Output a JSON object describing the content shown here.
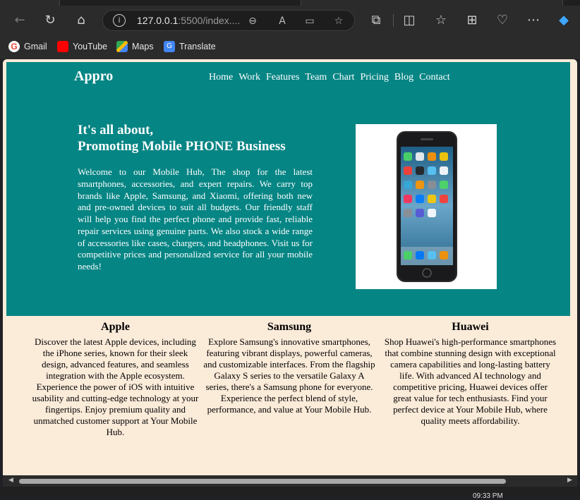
{
  "browser": {
    "url_host": "127.0.0.1",
    "url_rest": ":5500/index....",
    "bookmarks": [
      {
        "label": "Gmail",
        "color": "#ea4335"
      },
      {
        "label": "YouTube",
        "color": "#ff0000"
      },
      {
        "label": "Maps",
        "color": "#34a853"
      },
      {
        "label": "Translate",
        "color": "#4285f4"
      }
    ]
  },
  "site": {
    "logo": "Appro",
    "nav": [
      "Home",
      "Work",
      "Features",
      "Team",
      "Chart",
      "Pricing",
      "Blog",
      "Contact"
    ],
    "hero": {
      "headline_line1": "It's all about,",
      "headline_line2": "Promoting Mobile PHONE Business",
      "intro": "Welcome to our Mobile Hub, The shop for the latest smartphones, accessories, and expert repairs. We carry top brands like Apple, Samsung, and Xiaomi, offering both new and pre-owned devices to suit all budgets. Our friendly staff will help you find the perfect phone and provide fast, reliable repair services using genuine parts. We also stock a wide range of accessories like cases, chargers, and headphones. Visit us for competitive prices and personalized service for all your mobile needs!"
    },
    "brands": [
      {
        "name": "Apple",
        "text": "Discover the latest Apple devices, including the iPhone series, known for their sleek design, advanced features, and seamless integration with the Apple ecosystem. Experience the power of iOS with intuitive usability and cutting-edge technology at your fingertips. Enjoy premium quality and unmatched customer support at Your Mobile Hub."
      },
      {
        "name": "Samsung",
        "text": "Explore Samsung's innovative smartphones, featuring vibrant displays, powerful cameras, and customizable interfaces. From the flagship Galaxy S series to the versatile Galaxy A series, there's a Samsung phone for everyone. Experience the perfect blend of style, performance, and value at Your Mobile Hub."
      },
      {
        "name": "Huawei",
        "text": "Shop Huawei's high-performance smartphones that combine stunning design with exceptional camera capabilities and long-lasting battery life. With advanced AI technology and competitive pricing, Huawei devices offer great value for tech enthusiasts. Find your perfect device at Your Mobile Hub, where quality meets affordability."
      }
    ]
  },
  "taskbar": {
    "clock": "09:33 PM"
  },
  "colors": {
    "hero_bg": "#058584",
    "page_bg": "#fbebd9"
  }
}
